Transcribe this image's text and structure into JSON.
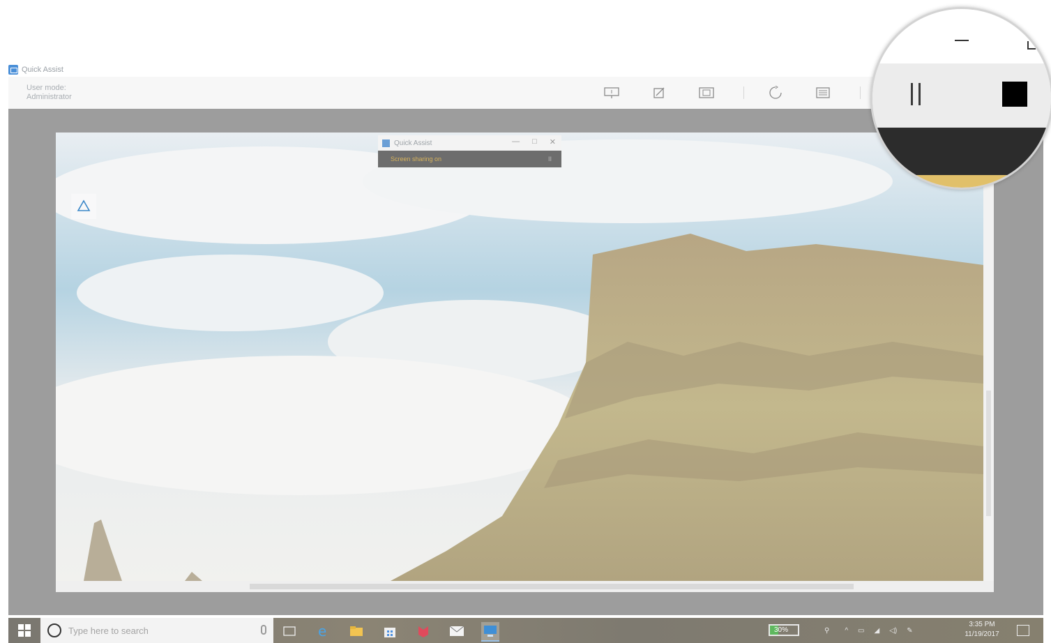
{
  "window": {
    "title": "Quick Assist"
  },
  "toolbar": {
    "user_mode_label": "User mode:",
    "user_mode_value": "Administrator",
    "buttons": [
      "select-monitor-icon",
      "annotate-icon",
      "actual-size-icon",
      "restart-icon",
      "task-manager-icon"
    ]
  },
  "popup": {
    "title": "Quick Assist",
    "status": "Screen sharing on",
    "min": "—",
    "max": "□",
    "close": "✕",
    "pause": "II"
  },
  "magnifier": {
    "minimize": "—",
    "pause_icon": "pause-icon",
    "stop_icon": "stop-icon"
  },
  "taskbar": {
    "search_placeholder": "Type here to search",
    "battery": "30%",
    "battery_level": 0.3,
    "time": "3:35 PM",
    "date": "11/19/2017"
  },
  "colors": {
    "toolbar_bg": "#f7f7f7",
    "viewer_bg": "#9d9d9d",
    "popup_status_text": "#d7b35c",
    "stop_button": "#000000"
  }
}
